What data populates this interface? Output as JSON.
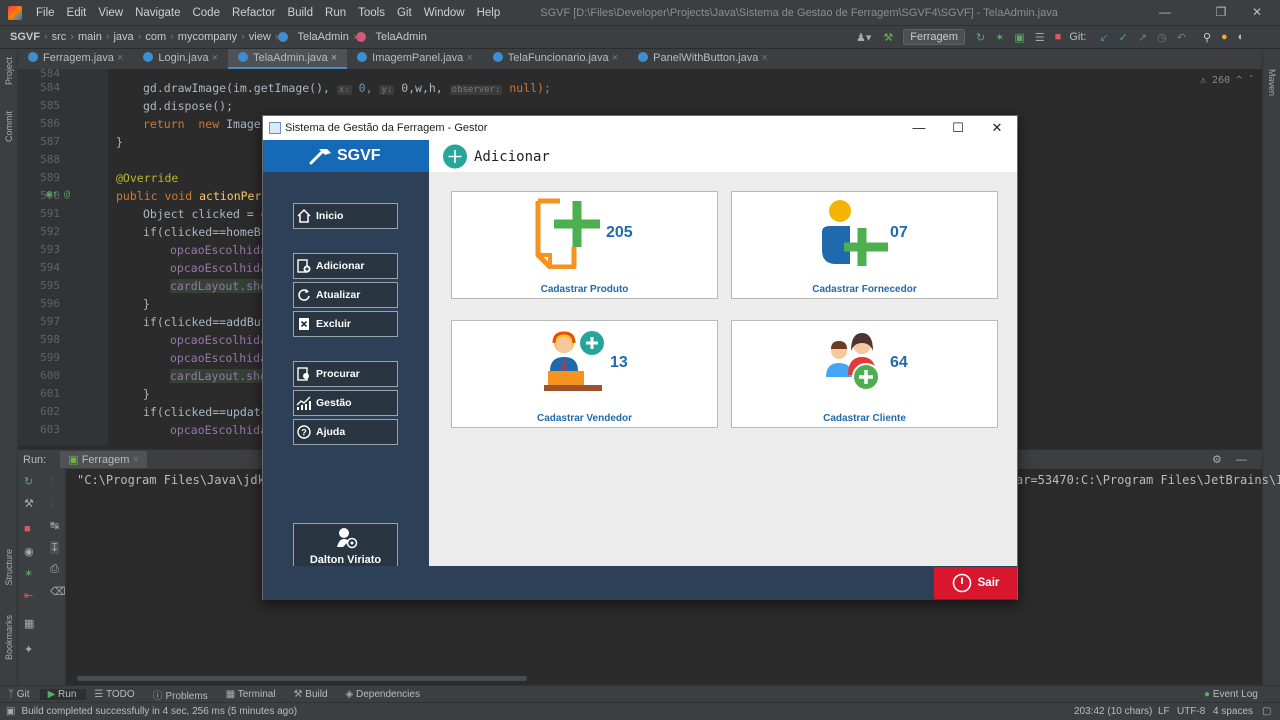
{
  "ide": {
    "menus": [
      "File",
      "Edit",
      "View",
      "Navigate",
      "Code",
      "Refactor",
      "Build",
      "Run",
      "Tools",
      "Git",
      "Window",
      "Help"
    ],
    "window_title": "SGVF [D:\\Files\\Developer\\Projects\\Java\\Sistema de Gestao de Ferragem\\SGVF4\\SGVF] - TelaAdmin.java",
    "breadcrumbs": [
      "SGVF",
      "src",
      "main",
      "java",
      "com",
      "mycompany",
      "view",
      "TelaAdmin",
      "TelaAdmin"
    ],
    "run_config": "Ferragem",
    "git_label": "Git:",
    "tabs": [
      "Ferragem.java",
      "Login.java",
      "TelaAdmin.java",
      "ImagemPanel.java",
      "TelaFuncionario.java",
      "PanelWithButton.java"
    ],
    "active_tab": "TelaAdmin.java",
    "inspection_count": "260",
    "left_strip": [
      "Project",
      "Commit",
      "Structure",
      "Bookmarks"
    ],
    "right_strip": [
      "Maven"
    ],
    "run_tab_label": "Run:",
    "run_tab_name": "Ferragem",
    "run_output": "\"C:\\Program Files\\Java\\jdk-1",
    "run_output_right": "ar=53470:C:\\Program Files\\JetBrains\\I",
    "tool_tabs": [
      "Git",
      "Run",
      "TODO",
      "Problems",
      "Terminal",
      "Build",
      "Dependencies"
    ],
    "event_log": "Event Log",
    "status_message": "Build completed successfully in 4 sec, 256 ms (5 minutes ago)",
    "status_position": "203:42 (10 chars)",
    "status_lf": "LF",
    "status_encoding": "UTF-8",
    "status_indent": "4 spaces"
  },
  "code": {
    "line_numbers": [
      "584",
      "585",
      "586",
      "587",
      "588",
      "589",
      "590",
      "591",
      "592",
      "593",
      "594",
      "595",
      "596",
      "597",
      "598",
      "599",
      "600",
      "601",
      "602",
      "603"
    ],
    "lines": {
      "l584_a": "gd.drawImage(im.getImage(), ",
      "l584_hx": "x:",
      "l584_b": " 0, ",
      "l584_hy": "y:",
      "l584_c": " 0,w,h, ",
      "l584_ho": "observer:",
      "l584_d": " null);",
      "l585": "gd.dispose();",
      "l586_kw": "return  new",
      "l586_rest": " ImageI",
      "l587": "}",
      "l589": "@Override",
      "l590_kw": "public void",
      "l590_fn": " actionPerf",
      "l591": "Object clicked = e",
      "l592": "if(clicked==homeBu",
      "l593": "opcaoEscolhida",
      "l594": "opcaoEscolhida",
      "l595": "cardLayout.sho",
      "l596": "}",
      "l597": "if(clicked==addBut",
      "l598": "opcaoEscolhida",
      "l599": "opcaoEscolhida",
      "l600": "cardLayout.sho",
      "l601": "}",
      "l602": "if(clicked==update",
      "l603": "opcaoEscolhida"
    }
  },
  "app": {
    "window_title": "Sistema de Gestão da Ferragem - Gestor",
    "brand": "SGVF",
    "section_title": "Adicionar",
    "nav": [
      {
        "label": "Inicio",
        "icon": "home-icon"
      },
      {
        "label": "Adicionar",
        "icon": "add-doc-icon"
      },
      {
        "label": "Atualizar",
        "icon": "refresh-icon"
      },
      {
        "label": "Excluir",
        "icon": "delete-icon"
      },
      {
        "label": "Procurar",
        "icon": "search-doc-icon"
      },
      {
        "label": "Gestão",
        "icon": "chart-icon"
      },
      {
        "label": "Ajuda",
        "icon": "help-icon"
      }
    ],
    "user_name": "Dalton Viriato",
    "cards": [
      {
        "label": "Cadastrar Produto",
        "count": "205"
      },
      {
        "label": "Cadastrar Fornecedor",
        "count": "07"
      },
      {
        "label": "Cadastrar Vendedor",
        "count": "13"
      },
      {
        "label": "Cadastrar Cliente",
        "count": "64"
      }
    ],
    "exit_label": "Sair",
    "colors": {
      "sidebar": "#2e4057",
      "brand": "#1669b6",
      "accent": "#1f6aad",
      "exit": "#d8172f"
    }
  }
}
